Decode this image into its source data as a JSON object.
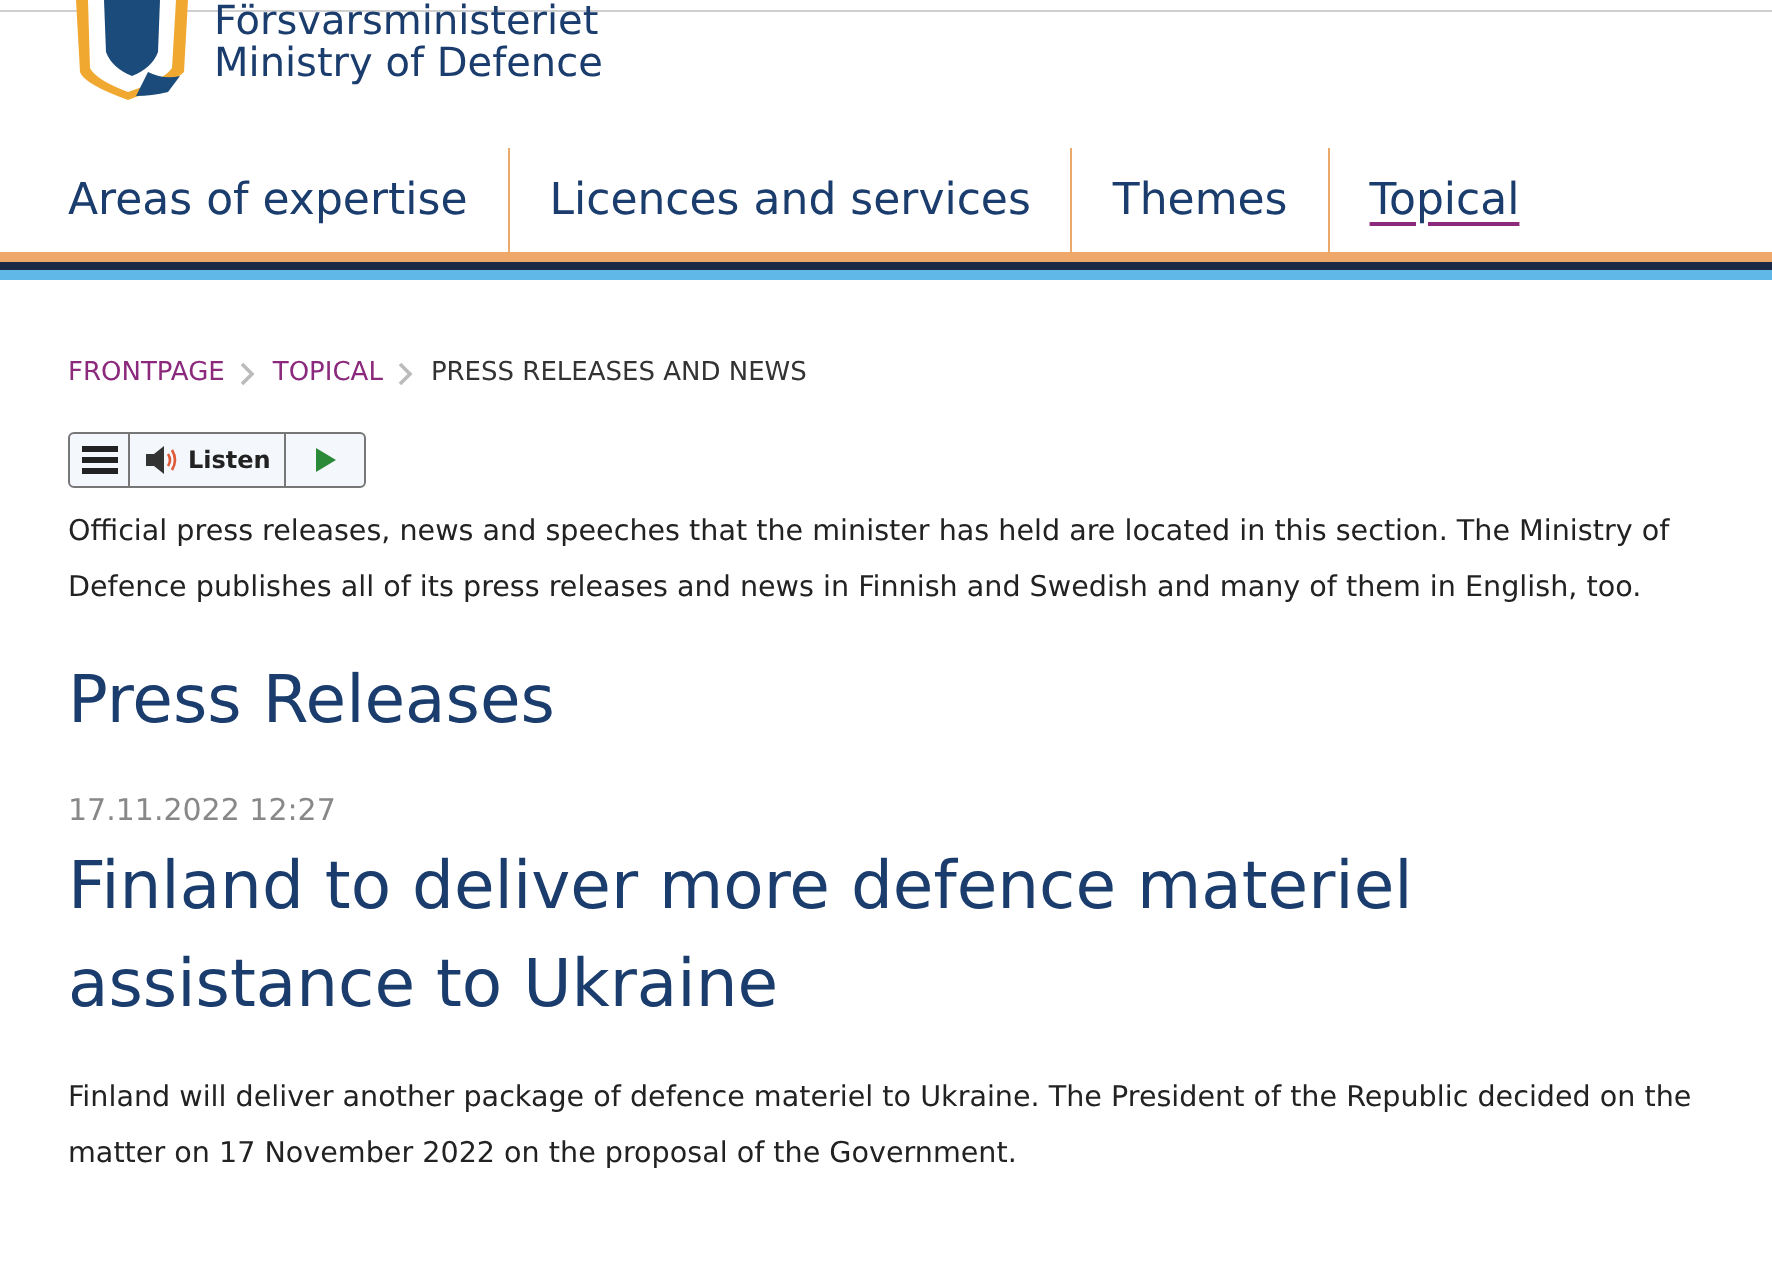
{
  "header": {
    "logo_lines": [
      "Försvarsministeriet",
      "Ministry of Defence"
    ]
  },
  "nav": [
    {
      "label": "Areas of expertise",
      "selected": false
    },
    {
      "label": "Licences and services",
      "selected": false
    },
    {
      "label": "Themes",
      "selected": false
    },
    {
      "label": "Topical",
      "selected": true
    }
  ],
  "breadcrumb": [
    {
      "label": "FRONTPAGE",
      "kind": "link"
    },
    {
      "label": "TOPICAL",
      "kind": "link"
    },
    {
      "label": "PRESS RELEASES AND NEWS",
      "kind": "current"
    }
  ],
  "listen_toolbar": {
    "label": "Listen"
  },
  "intro": "Official press releases, news and speeches that the minister has held are located in this section. The Ministry of Defence publishes all of its press releases and news in Finnish and Swedish and many of them in English, too.",
  "section_title": "Press Releases",
  "article": {
    "date": "17.11.2022 12:27",
    "title": "Finland to deliver more defence materiel assistance to Ukraine",
    "summary": "Finland will deliver another package of defence materiel to Ukraine. The President of the Republic decided on the matter on 17 November 2022 on the proposal of the Government."
  }
}
